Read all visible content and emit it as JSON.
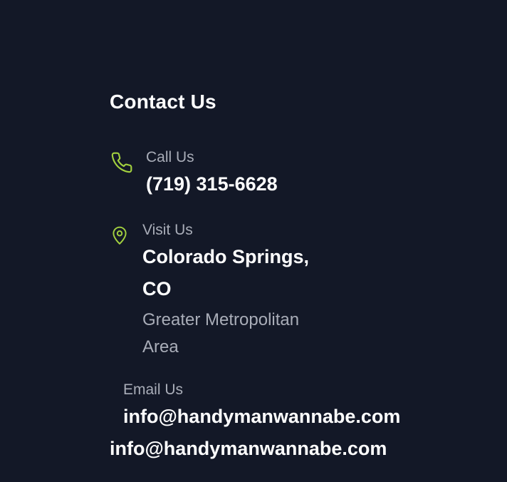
{
  "section": {
    "heading": "Contact Us"
  },
  "phone": {
    "label": "Call Us",
    "value": "(719) 315-6628",
    "icon": "phone-icon"
  },
  "location": {
    "label": "Visit Us",
    "value_line1": "Colorado Springs,",
    "value_line2": "CO",
    "subtext_line1": "Greater Metropolitan",
    "subtext_line2": "Area",
    "icon": "map-pin-icon"
  },
  "email": {
    "label": "Email Us",
    "value": "info@handymanwannabe.com",
    "footer_email": "info@handymanwannabe.com"
  },
  "colors": {
    "background": "#131827",
    "accent": "#A3D13F",
    "label": "#A9ADB8",
    "text": "#FFFFFF"
  }
}
